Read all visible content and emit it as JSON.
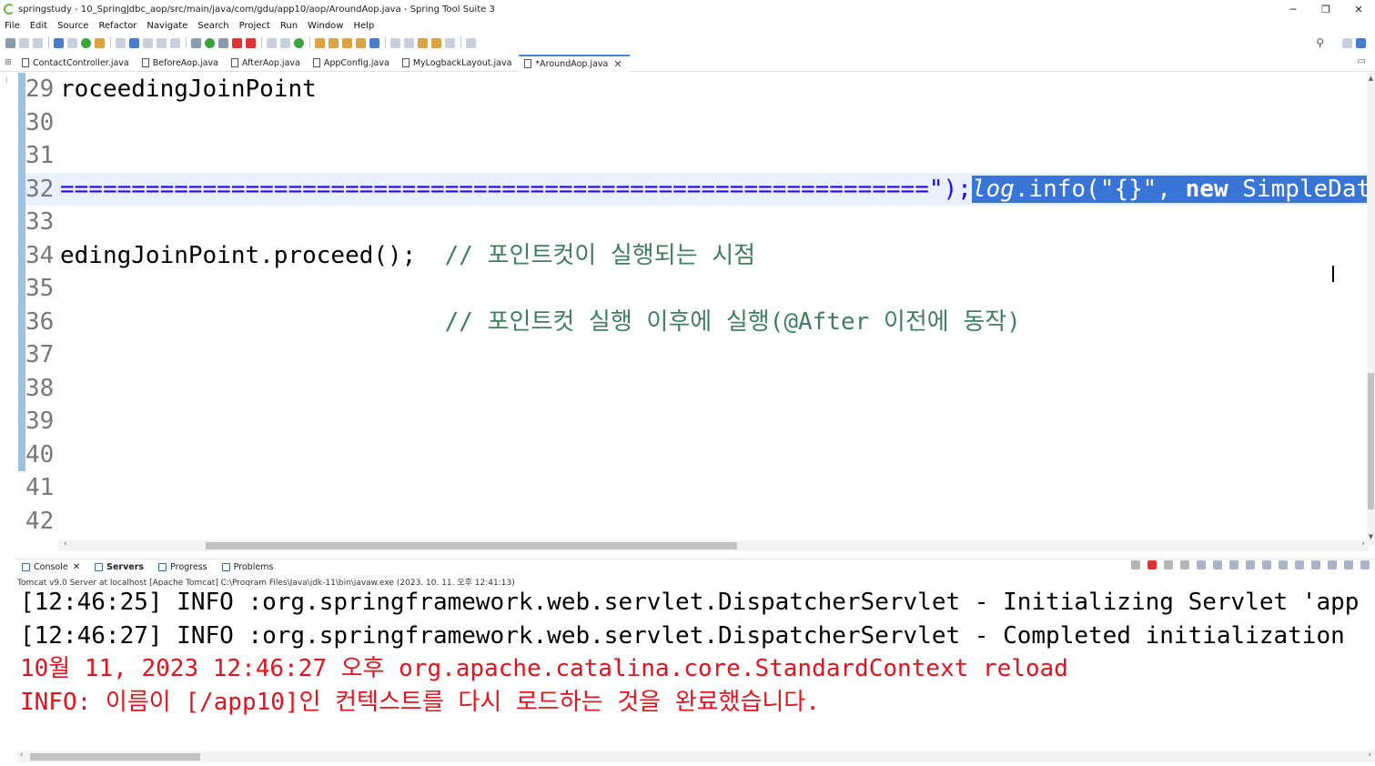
{
  "window": {
    "title": "springstudy - 10_SpringJdbc_aop/src/main/java/com/gdu/app10/aop/AroundAop.java - Spring Tool Suite 3",
    "minimize": "─",
    "restore": "❐",
    "close": "✕"
  },
  "menu": [
    "File",
    "Edit",
    "Source",
    "Refactor",
    "Navigate",
    "Search",
    "Project",
    "Run",
    "Window",
    "Help"
  ],
  "editor_tabs": [
    {
      "label": "ContactController.java",
      "active": false
    },
    {
      "label": "BeforeAop.java",
      "active": false
    },
    {
      "label": "AfterAop.java",
      "active": false
    },
    {
      "label": "AppConfig.java",
      "active": false
    },
    {
      "label": "MyLogbackLayout.java",
      "active": false
    },
    {
      "label": "*AroundAop.java",
      "active": true
    }
  ],
  "tab_close": "✕",
  "code_lines": [
    {
      "num": "29",
      "text": "roceedingJoinPoint"
    },
    {
      "num": "30",
      "text": ""
    },
    {
      "num": "31",
      "text": ""
    },
    {
      "num": "32",
      "pre": "=============================================================\");",
      "sel_field": "log",
      "sel_mid": ".info(",
      "sel_str": "\"{}\"",
      "sel_comma": ", ",
      "sel_kw": "new",
      "sel_rest": " SimpleDate"
    },
    {
      "num": "33",
      "text": ""
    },
    {
      "num": "34",
      "code": "edingJoinPoint.proceed();  ",
      "comment": "// 포인트컷이 실행되는 시점"
    },
    {
      "num": "35",
      "text": ""
    },
    {
      "num": "36",
      "code": "                           ",
      "comment": "// 포인트컷 실행 이후에 실행(@After 이전에 동작)"
    },
    {
      "num": "37",
      "text": ""
    },
    {
      "num": "38",
      "text": ""
    },
    {
      "num": "39",
      "text": ""
    },
    {
      "num": "40",
      "text": ""
    },
    {
      "num": "41",
      "text": ""
    },
    {
      "num": "42",
      "text": ""
    }
  ],
  "console": {
    "tabs": [
      {
        "label": "Console",
        "close": "✕"
      },
      {
        "label": "Servers"
      },
      {
        "label": "Progress"
      },
      {
        "label": "Problems"
      }
    ],
    "description": "Tomcat v9.0 Server at localhost [Apache Tomcat] C:\\Program Files\\Java\\jdk-11\\bin\\javaw.exe  (2023. 10. 11. 오후 12:41:13)",
    "lines": [
      {
        "text": "[12:46:25] INFO :org.springframework.web.servlet.DispatcherServlet - Initializing Servlet 'app",
        "type": "info"
      },
      {
        "text": "[12:46:27] INFO :org.springframework.web.servlet.DispatcherServlet - Completed initialization",
        "type": "info"
      },
      {
        "text": "10월 11, 2023 12:46:27 오후 org.apache.catalina.core.StandardContext reload",
        "type": "err"
      },
      {
        "text": "INFO: 이름이 [/app10]인 컨텍스트를 다시 로드하는 것을 완료했습니다.",
        "type": "err"
      }
    ]
  },
  "colors": {
    "keyword": "#7f0055",
    "comment": "#3f7f5f",
    "string": "#2a00ff",
    "selection": "#3875d7",
    "console_error": "#e0141e",
    "change_bar": "#9fc2e4"
  }
}
